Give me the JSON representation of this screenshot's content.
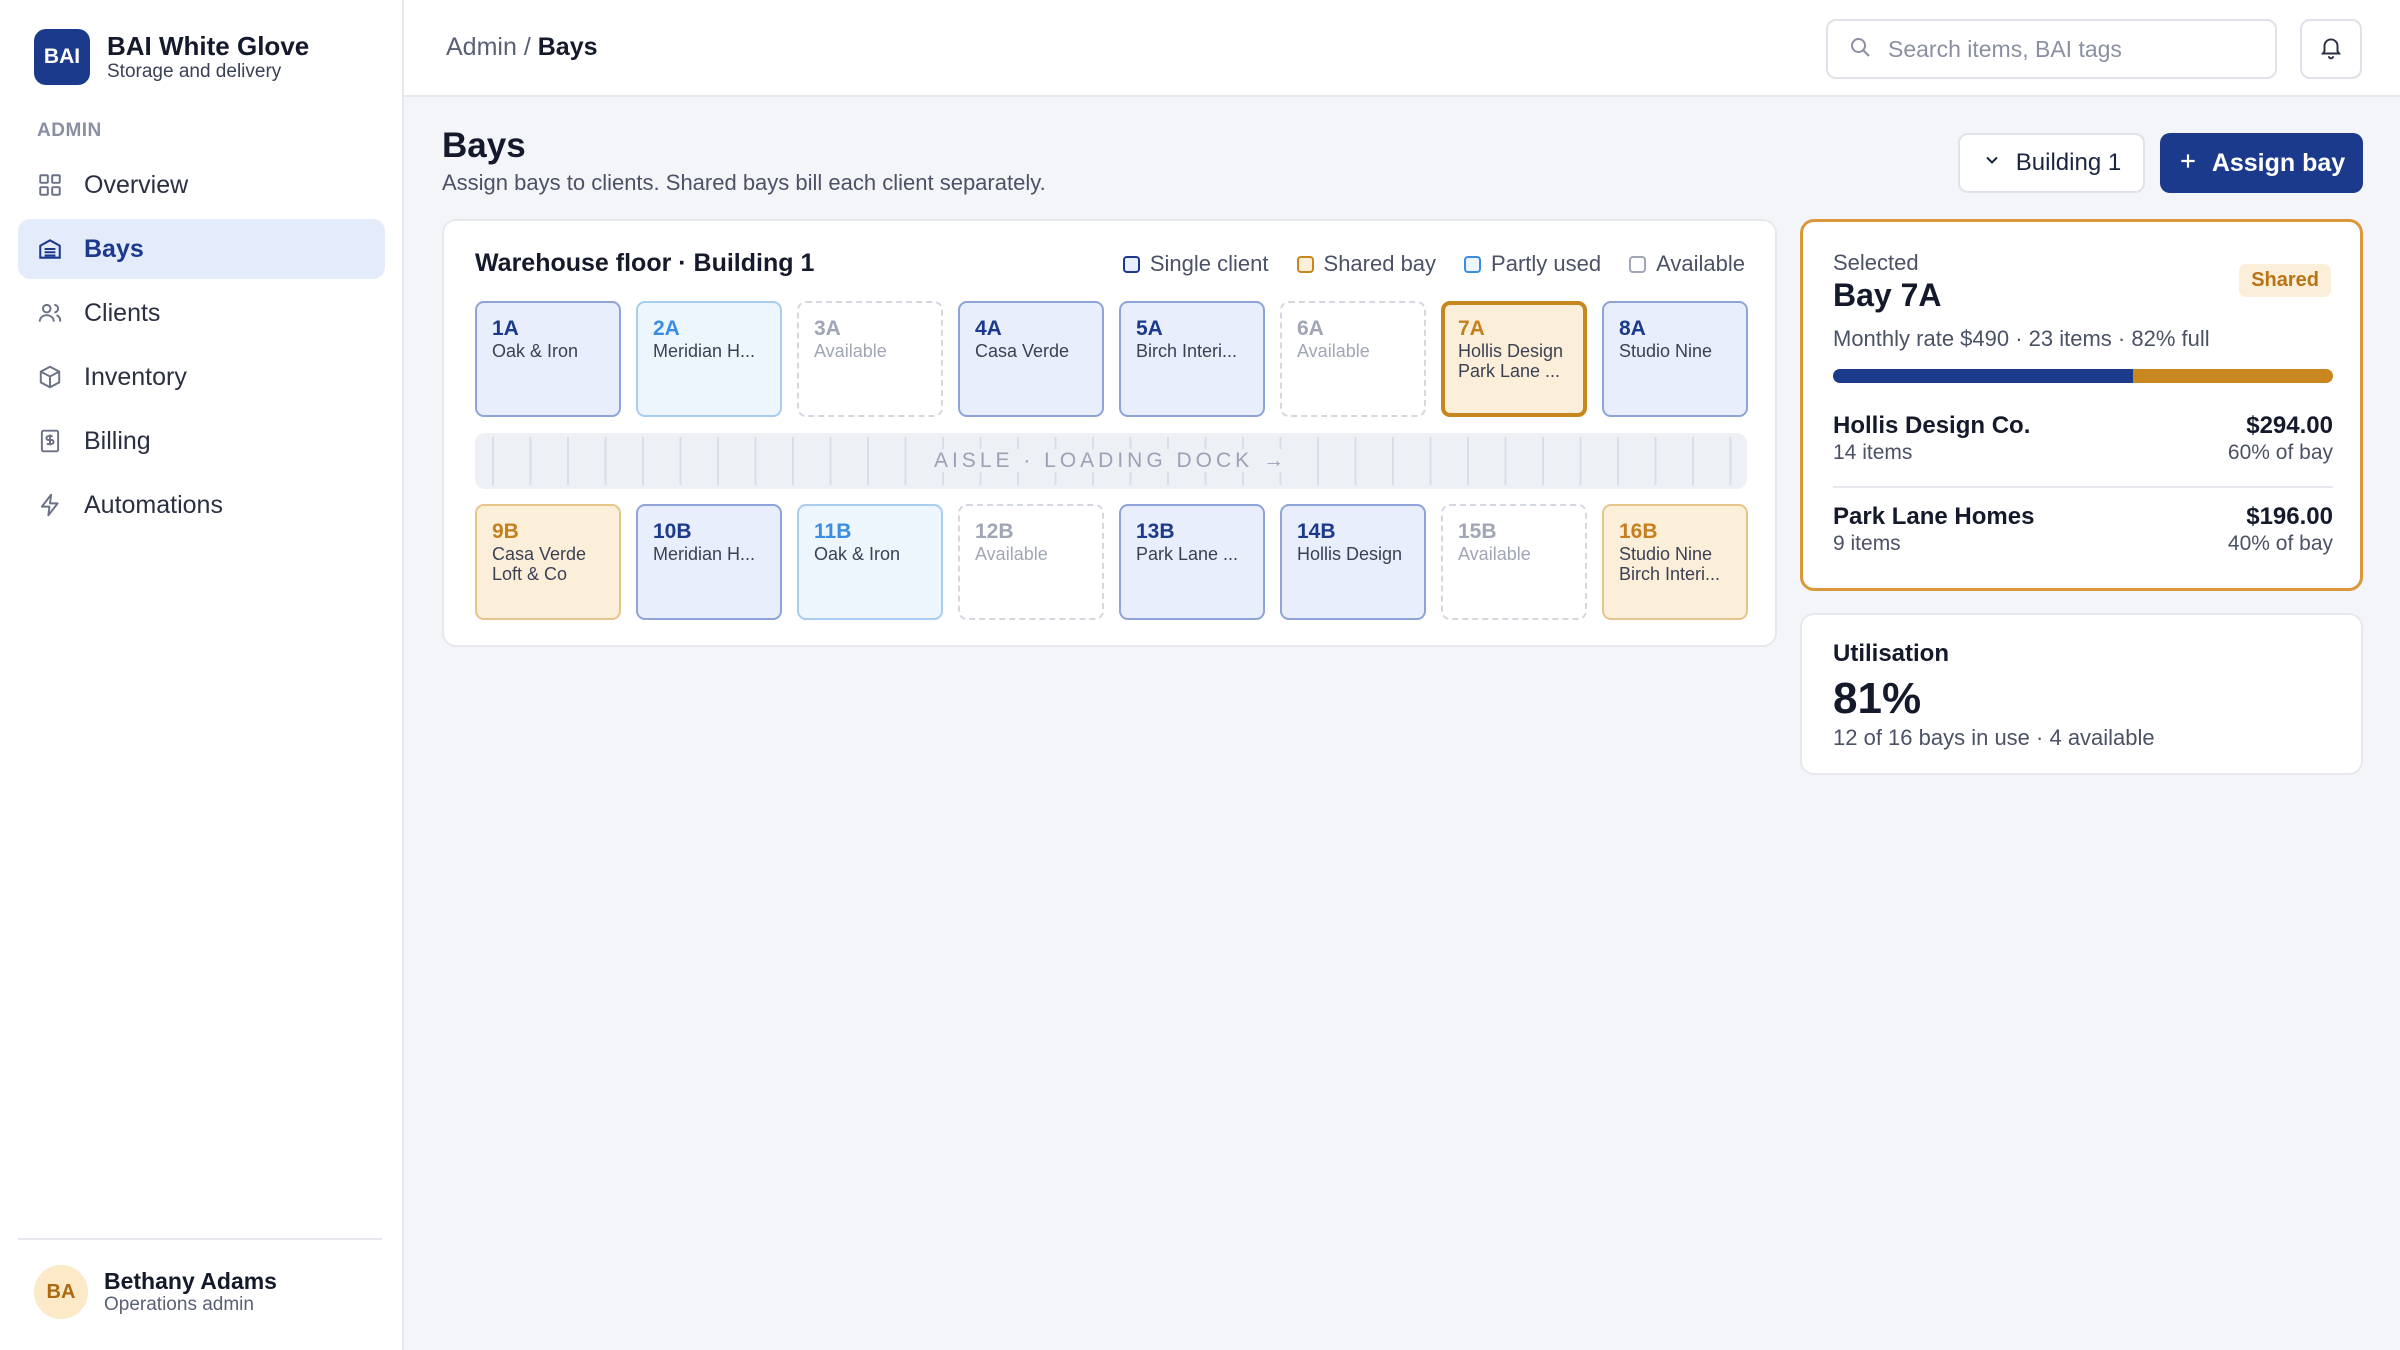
{
  "brand": {
    "logo": "BAI",
    "name": "BAI White Glove",
    "subtitle": "Storage and delivery"
  },
  "sidebar": {
    "section": "ADMIN",
    "items": [
      {
        "label": "Overview",
        "icon": "grid-icon",
        "active": false
      },
      {
        "label": "Bays",
        "icon": "warehouse-icon",
        "active": true
      },
      {
        "label": "Clients",
        "icon": "users-icon",
        "active": false
      },
      {
        "label": "Inventory",
        "icon": "box-icon",
        "active": false
      },
      {
        "label": "Billing",
        "icon": "receipt-icon",
        "active": false
      },
      {
        "label": "Automations",
        "icon": "bolt-icon",
        "active": false
      }
    ],
    "user": {
      "initials": "BA",
      "name": "Bethany Adams",
      "role": "Operations admin"
    }
  },
  "topbar": {
    "breadcrumb_root": "Admin",
    "breadcrumb_sep": "/",
    "breadcrumb_current": "Bays",
    "search_placeholder": "Search items, BAI tags"
  },
  "page": {
    "title": "Bays",
    "subtitle": "Assign bays to clients. Shared bays bill each client separately.",
    "building_button": "Building 1",
    "assign_button": "Assign bay"
  },
  "floor": {
    "title": "Warehouse floor · Building 1",
    "legend": [
      {
        "label": "Single client",
        "color": "#1c3a8c",
        "fill": "#e8eefb"
      },
      {
        "label": "Shared bay",
        "color": "#c8861f",
        "fill": "#fcefd9"
      },
      {
        "label": "Partly used",
        "color": "#3a8de0",
        "fill": "#eef6fd"
      },
      {
        "label": "Available",
        "color": "#a0a6b5",
        "fill": "#ffffff"
      }
    ],
    "aisle_label": "AISLE · LOADING DOCK →",
    "top_row": [
      {
        "id": "1A",
        "status": "single",
        "lines": [
          "Oak & Iron"
        ]
      },
      {
        "id": "2A",
        "status": "partly",
        "lines": [
          "Meridian H..."
        ]
      },
      {
        "id": "3A",
        "status": "avail",
        "lines": [
          "Available"
        ]
      },
      {
        "id": "4A",
        "status": "single",
        "lines": [
          "Casa Verde"
        ]
      },
      {
        "id": "5A",
        "status": "single",
        "lines": [
          "Birch Interi..."
        ]
      },
      {
        "id": "6A",
        "status": "avail",
        "lines": [
          "Available"
        ]
      },
      {
        "id": "7A",
        "status": "selected",
        "lines": [
          "Hollis Design",
          "Park Lane ..."
        ]
      },
      {
        "id": "8A",
        "status": "single",
        "lines": [
          "Studio Nine"
        ]
      }
    ],
    "bottom_row": [
      {
        "id": "9B",
        "status": "shared",
        "lines": [
          "Casa Verde",
          "Loft & Co"
        ]
      },
      {
        "id": "10B",
        "status": "single",
        "lines": [
          "Meridian H..."
        ]
      },
      {
        "id": "11B",
        "status": "partly",
        "lines": [
          "Oak & Iron"
        ]
      },
      {
        "id": "12B",
        "status": "avail",
        "lines": [
          "Available"
        ]
      },
      {
        "id": "13B",
        "status": "single",
        "lines": [
          "Park Lane ..."
        ]
      },
      {
        "id": "14B",
        "status": "single",
        "lines": [
          "Hollis Design"
        ]
      },
      {
        "id": "15B",
        "status": "avail",
        "lines": [
          "Available"
        ]
      },
      {
        "id": "16B",
        "status": "shared",
        "lines": [
          "Studio Nine",
          "Birch Interi..."
        ]
      }
    ]
  },
  "selected": {
    "kicker": "Selected",
    "title": "Bay 7A",
    "badge": "Shared",
    "meta": "Monthly rate $490 · 23 items · 82% full",
    "share_split": [
      0.6,
      0.4
    ],
    "clients": [
      {
        "name": "Hollis Design Co.",
        "items": "14 items",
        "amount": "$294.00",
        "share": "60% of bay"
      },
      {
        "name": "Park Lane Homes",
        "items": "9 items",
        "amount": "$196.00",
        "share": "40% of bay"
      }
    ]
  },
  "utilisation": {
    "title": "Utilisation",
    "value": "81%",
    "note": "12 of 16 bays in use · 4 available"
  }
}
